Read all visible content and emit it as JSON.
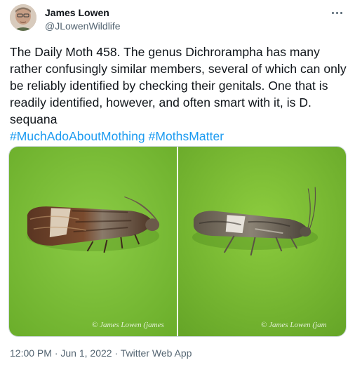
{
  "author": {
    "display_name": "James Lowen",
    "handle": "@JLowenWildlife",
    "avatar_icon": "profile-photo"
  },
  "tweet": {
    "text": "The Daily Moth 458. The genus Dichrorampha has many rather confusingly similar members, several of which can only be reliably identified by checking their genitals. One that is readily identified, however, and often smart with it, is D. sequana",
    "hashtags": [
      "#MuchAdoAboutMothing",
      "#MothsMatter"
    ]
  },
  "media": {
    "photos": [
      {
        "credit": "© James Lowen (james"
      },
      {
        "credit": "© James Lowen (jam"
      }
    ]
  },
  "meta": {
    "time": "12:00 PM",
    "date": "Jun 1, 2022",
    "source": "Twitter Web App",
    "separator": " · "
  },
  "colors": {
    "accent": "#1d9bf0",
    "text": "#0f1419",
    "secondary": "#536471",
    "photo_bg_left": "#7fc13a",
    "photo_bg_right": "#7dbd33"
  }
}
